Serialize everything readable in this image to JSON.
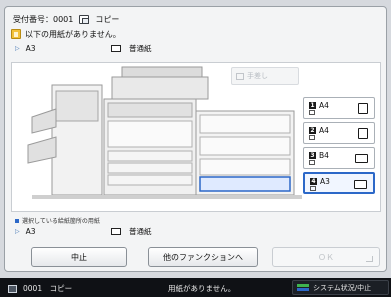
{
  "header": {
    "job_number": "受付番号：0001",
    "mode": "コピー",
    "message": "以下の用紙がありません。"
  },
  "required_paper": {
    "size": "A3",
    "type": "普通紙"
  },
  "manual_feed": {
    "label": "手差し",
    "enabled": false
  },
  "drawers": [
    {
      "num": "1",
      "size": "A4",
      "selected": false
    },
    {
      "num": "2",
      "size": "A4",
      "selected": false
    },
    {
      "num": "3",
      "size": "B4",
      "selected": false
    },
    {
      "num": "4",
      "size": "A3",
      "selected": true
    }
  ],
  "legend": "選択している給紙箇所の用紙",
  "selected_paper": {
    "size": "A3",
    "type": "普通紙"
  },
  "buttons": {
    "cancel": "中止",
    "other_function": "他のファンクションへ",
    "ok": "ＯＫ"
  },
  "statusbar": {
    "job": "0001　コピー",
    "message": "用紙がありません。",
    "system_button": "システム状況/中止"
  },
  "colors": {
    "accent": "#2c68c8",
    "status_bar": "#0f1115",
    "message_icon": "#f3c23a"
  }
}
